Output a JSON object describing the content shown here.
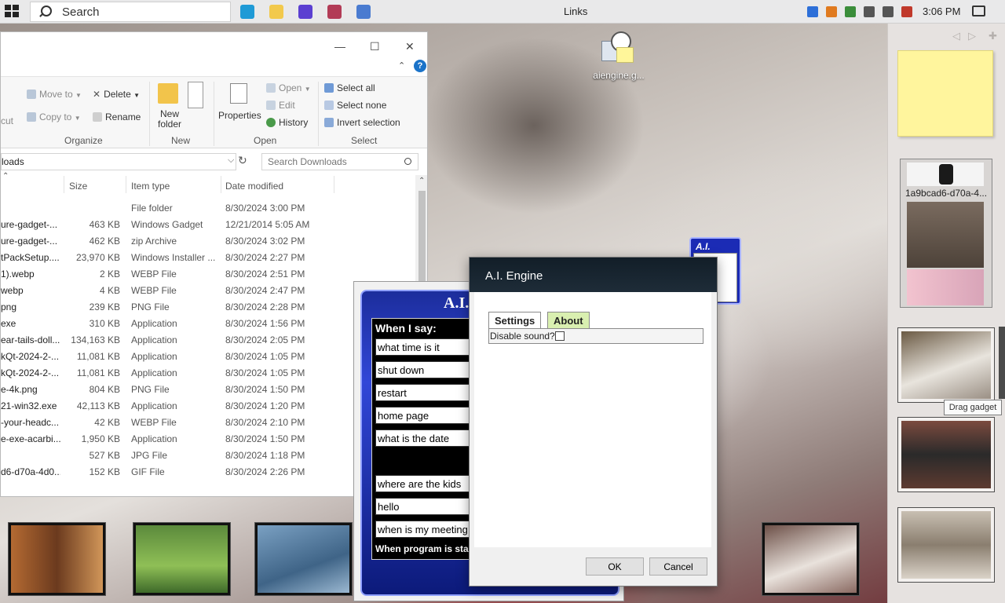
{
  "taskbar": {
    "search_placeholder": "Search",
    "window_title": "Links",
    "clock": "3:06 PM",
    "apps": [
      {
        "name": "edge-icon",
        "color": "#1f9ad6"
      },
      {
        "name": "file-explorer-icon",
        "color": "#f2c94c"
      },
      {
        "name": "winamp-icon",
        "color": "#5b3fd1"
      },
      {
        "name": "flag-app-icon",
        "color": "#b23b56"
      },
      {
        "name": "store-icon",
        "color": "#4a7bd0"
      }
    ],
    "tray": [
      {
        "name": "bluetooth-icon",
        "color": "#2d6fd8"
      },
      {
        "name": "search-tool-icon",
        "color": "#e07a1f"
      },
      {
        "name": "shield-icon",
        "color": "#3a8d3a"
      },
      {
        "name": "usb-icon",
        "color": "#555555"
      },
      {
        "name": "network-icon",
        "color": "#555555"
      },
      {
        "name": "volume-muted-icon",
        "color": "#c0392b"
      }
    ]
  },
  "explorer": {
    "ribbon": {
      "cut": "cut",
      "move_to": "Move to",
      "copy_to": "Copy to",
      "delete": "Delete",
      "rename": "Rename",
      "organize": "Organize",
      "new_folder": "New folder",
      "new_group": "New",
      "properties": "Properties",
      "open_item": "Open",
      "edit": "Edit",
      "history": "History",
      "open_group": "Open",
      "select_all": "Select all",
      "select_none": "Select none",
      "invert_selection": "Invert selection",
      "select_group": "Select"
    },
    "address": "loads",
    "search_placeholder": "Search Downloads",
    "columns": {
      "size": "Size",
      "type": "Item type",
      "date": "Date modified"
    },
    "files": [
      {
        "name": "",
        "size": "",
        "type": "File folder",
        "date": "8/30/2024 3:00 PM"
      },
      {
        "name": "ure-gadget-...",
        "size": "463 KB",
        "type": "Windows Gadget",
        "date": "12/21/2014 5:05 AM"
      },
      {
        "name": "ure-gadget-...",
        "size": "462 KB",
        "type": "zip Archive",
        "date": "8/30/2024 3:02 PM"
      },
      {
        "name": "tPackSetup....",
        "size": "23,970 KB",
        "type": "Windows Installer ...",
        "date": "8/30/2024 2:27 PM"
      },
      {
        "name": "1).webp",
        "size": "2 KB",
        "type": "WEBP File",
        "date": "8/30/2024 2:51 PM"
      },
      {
        "name": "webp",
        "size": "4 KB",
        "type": "WEBP File",
        "date": "8/30/2024 2:47 PM"
      },
      {
        "name": "png",
        "size": "239 KB",
        "type": "PNG File",
        "date": "8/30/2024 2:28 PM"
      },
      {
        "name": "exe",
        "size": "310 KB",
        "type": "Application",
        "date": "8/30/2024 1:56 PM"
      },
      {
        "name": "ear-tails-doll...",
        "size": "134,163 KB",
        "type": "Application",
        "date": "8/30/2024 2:05 PM"
      },
      {
        "name": "kQt-2024-2-...",
        "size": "11,081 KB",
        "type": "Application",
        "date": "8/30/2024 1:05 PM"
      },
      {
        "name": "kQt-2024-2-...",
        "size": "11,081 KB",
        "type": "Application",
        "date": "8/30/2024 1:05 PM"
      },
      {
        "name": "e-4k.png",
        "size": "804 KB",
        "type": "PNG File",
        "date": "8/30/2024 1:50 PM"
      },
      {
        "name": "21-win32.exe",
        "size": "42,113 KB",
        "type": "Application",
        "date": "8/30/2024 1:20 PM"
      },
      {
        "name": "-your-headc...",
        "size": "42 KB",
        "type": "WEBP File",
        "date": "8/30/2024 2:10 PM"
      },
      {
        "name": "e-exe-acarbi...",
        "size": "1,950 KB",
        "type": "Application",
        "date": "8/30/2024 1:50 PM"
      },
      {
        "name": "",
        "size": "527 KB",
        "type": "JPG File",
        "date": "8/30/2024 1:18 PM"
      },
      {
        "name": "d6-d70a-4d0...",
        "size": "152 KB",
        "type": "GIF File",
        "date": "8/30/2024 2:26 PM"
      }
    ]
  },
  "desktop_icon": {
    "label": "aiengine.g..."
  },
  "ai_gadget": {
    "logo": "A.I.",
    "header": "When I say:",
    "commands": [
      "what time is it",
      "shut down",
      "restart",
      "home page",
      "what is the date",
      "",
      "where are the kids",
      "hello",
      "when is my meeting"
    ],
    "footer": "When program is sta"
  },
  "mini_gadget": {
    "title": "A.I."
  },
  "dialog": {
    "title": "A.I. Engine",
    "tab_settings": "Settings",
    "tab_about": "About",
    "disable_sound": "Disable sound?",
    "ok": "OK",
    "cancel": "Cancel"
  },
  "sidebar": {
    "slideshow_caption": "1a9bcad6-d70a-4...",
    "tooltip": "Drag gadget"
  }
}
